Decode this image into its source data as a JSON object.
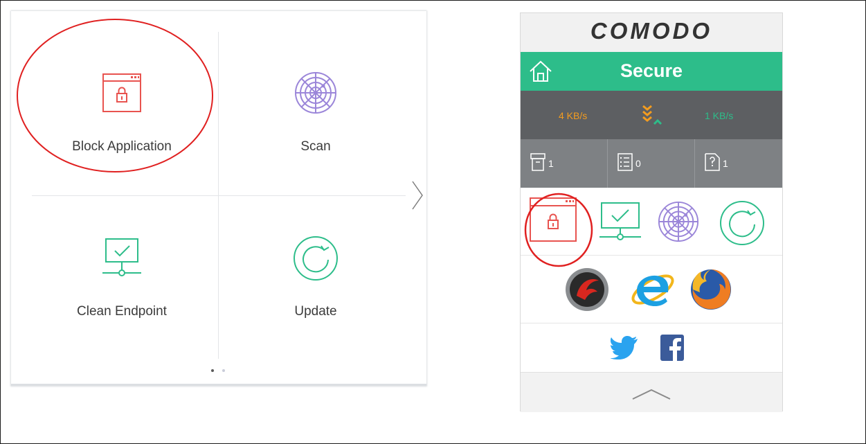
{
  "tasks_panel": {
    "tiles": [
      {
        "label": "Block Application",
        "icon": "lock-window-icon",
        "color": "#e8534f"
      },
      {
        "label": "Scan",
        "icon": "radar-icon",
        "color": "#9b86d9"
      },
      {
        "label": "Clean Endpoint",
        "icon": "monitor-check-icon",
        "color": "#2dbd8a"
      },
      {
        "label": "Update",
        "icon": "refresh-icon",
        "color": "#2dbd8a"
      }
    ],
    "pager": {
      "total_pages": 2,
      "current_page": 1
    },
    "highlight_color": "#e02020"
  },
  "widget": {
    "brand": "COMODO",
    "status": "Secure",
    "status_color": "#2dbd8a",
    "download_speed": "4 KB/s",
    "upload_speed": "1 KB/s",
    "download_color": "#f39c1f",
    "upload_color": "#2dbd8a",
    "counts": [
      {
        "icon": "quarantine-box-icon",
        "value": "1"
      },
      {
        "icon": "task-list-icon",
        "value": "0"
      },
      {
        "icon": "unknown-file-icon",
        "value": "1"
      }
    ],
    "task_icons": [
      "lock-window-icon",
      "monitor-check-icon",
      "radar-icon",
      "refresh-icon"
    ],
    "browsers": [
      "comodo-dragon-icon",
      "internet-explorer-icon",
      "firefox-icon"
    ],
    "social": [
      "twitter-icon",
      "facebook-icon"
    ]
  }
}
